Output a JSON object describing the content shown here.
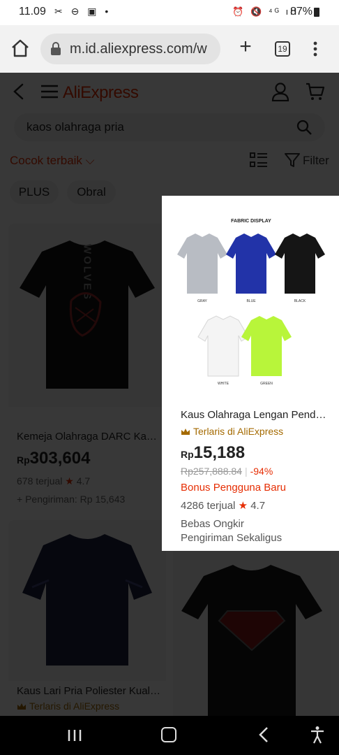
{
  "status": {
    "time": "11.09",
    "left_icons": "✂ ⊖ ▣ •",
    "right_icons": "⏰ 🔇 ⁴ᴳ ıll",
    "battery": "87%"
  },
  "browser": {
    "url": "m.id.aliexpress.com/w",
    "tab_count": "19"
  },
  "header": {
    "brand": "AliExpress"
  },
  "search": {
    "query": "kaos olahraga pria"
  },
  "sort": {
    "label": "Cocok terbaik",
    "filter_label": "Filter"
  },
  "chips": [
    "PLUS",
    "Obral"
  ],
  "products": [
    {
      "title": "Kemeja Olahraga DARC Kaus ...",
      "currency": "Rp",
      "price": "303,604",
      "sold": "678 terjual",
      "rating": "4.7",
      "shipping": "+ Pengiriman: Rp 15,643",
      "tee_color": "#161616",
      "print_text": "WOLVES"
    },
    {
      "title": "",
      "tee_color": "#1b1b1b"
    },
    {
      "title": "Kaus Lari Pria Poliester Kualit...",
      "badge": "Terlaris di AliExpress",
      "tee_color": "#1e2340"
    },
    {
      "title": "",
      "tee_color": "#1a1a1a"
    }
  ],
  "highlight": {
    "image_caption": "FABRIC DISPLAY",
    "swatches": [
      {
        "name": "GRAY",
        "color": "#b8bcc3"
      },
      {
        "name": "BLUE",
        "color": "#2233a8"
      },
      {
        "name": "BLACK",
        "color": "#151515"
      },
      {
        "name": "WHITE",
        "color": "#f4f4f4"
      },
      {
        "name": "GREEN",
        "color": "#b8f53a"
      }
    ],
    "title": "Kaus Olahraga Lengan Pende...",
    "badge": "Terlaris di AliExpress",
    "currency": "Rp",
    "price": "15,188",
    "old_price": "Rp257,888.84",
    "discount": "-94%",
    "bonus": "Bonus Pengguna Baru",
    "sold": "4286 terjual",
    "rating": "4.7",
    "shipping_line1": "Bebas Ongkir",
    "shipping_line2": "Pengiriman Sekaligus"
  },
  "colors": {
    "accent": "#e62e04",
    "badge_gold": "#a46a00"
  }
}
